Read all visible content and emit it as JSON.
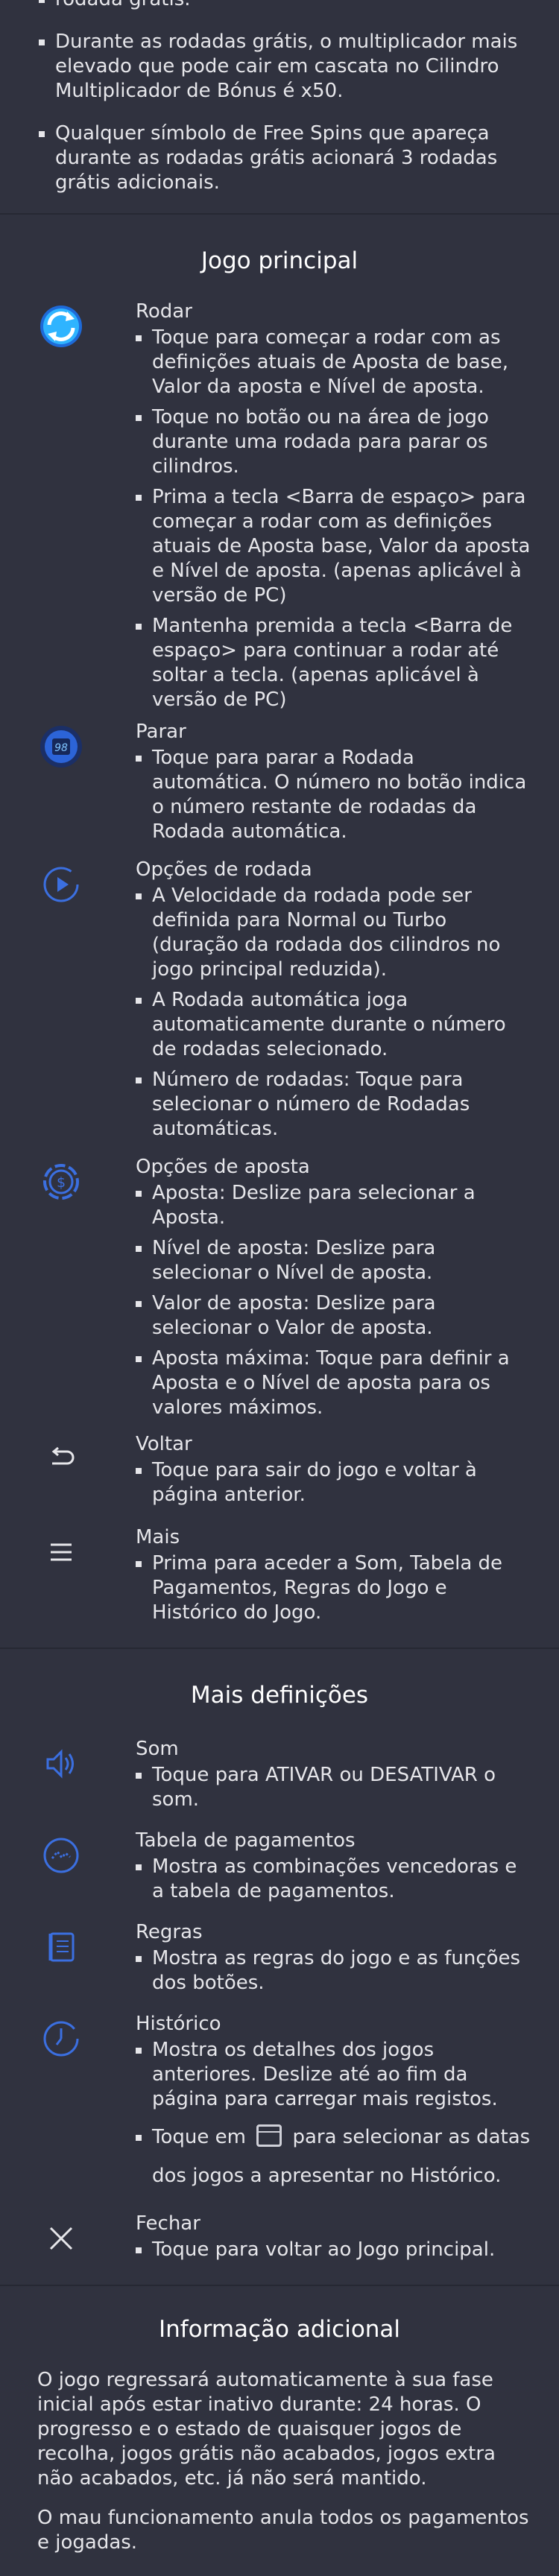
{
  "intro": {
    "bullets": [
      "rodada grátis.",
      "Durante as rodadas grátis, o multiplicador mais elevado que pode cair em cascata no Cilindro Multiplicador de Bónus é x50.",
      "Qualquer símbolo de Free Spins que apareça durante as rodadas grátis acionará 3 rodadas grátis adicionais."
    ]
  },
  "main_game": {
    "heading": "Jogo principal",
    "items": [
      {
        "icon": "spin-icon",
        "title": "Rodar",
        "bullets": [
          "Toque para começar a rodar com as definições atuais de Aposta de base, Valor da aposta e Nível de aposta.",
          "Toque no botão ou na área de jogo durante uma rodada para parar os cilindros.",
          "Prima a tecla <Barra de espaço> para começar a rodar com as definições atuais de Aposta base, Valor da aposta e Nível de aposta. (apenas aplicável à versão de PC)",
          "Mantenha premida a tecla <Barra de espaço> para continuar a rodar até soltar a tecla. (apenas aplicável à versão de PC)"
        ]
      },
      {
        "icon": "stop-icon",
        "icon_text": "98",
        "title": "Parar",
        "bullets": [
          "Toque para parar a Rodada automática. O número no botão indica o número restante de rodadas da Rodada automática."
        ]
      },
      {
        "icon": "spin-options-icon",
        "title": "Opções de rodada",
        "bullets": [
          "A Velocidade da rodada pode ser definida para Normal ou Turbo (duração da rodada dos cilindros no jogo principal reduzida).",
          "A Rodada automática joga automaticamente durante o número de rodadas selecionado.",
          "Número de rodadas: Toque para selecionar o número de Rodadas automáticas."
        ]
      },
      {
        "icon": "bet-options-icon",
        "title": "Opções de aposta",
        "bullets": [
          "Aposta: Deslize para selecionar a Aposta.",
          "Nível de aposta: Deslize para selecionar o Nível de aposta.",
          "Valor de aposta: Deslize para selecionar o Valor de aposta.",
          "Aposta máxima: Toque para definir a Aposta e o Nível de aposta para os valores máximos."
        ]
      },
      {
        "icon": "back-icon",
        "title": "Voltar",
        "bullets": [
          "Toque para sair do jogo e voltar à página anterior."
        ]
      },
      {
        "icon": "menu-icon",
        "title": "Mais",
        "bullets": [
          "Prima para aceder a Som, Tabela de Pagamentos, Regras do Jogo e Histórico do Jogo."
        ]
      }
    ]
  },
  "more_settings": {
    "heading": "Mais definições",
    "items": [
      {
        "icon": "sound-icon",
        "title": "Som",
        "bullets": [
          "Toque para ATIVAR ou DESATIVAR o som."
        ]
      },
      {
        "icon": "paytable-icon",
        "title": "Tabela de pagamentos",
        "bullets": [
          "Mostra as combinações vencedoras e a tabela de pagamentos."
        ]
      },
      {
        "icon": "rules-icon",
        "title": "Regras",
        "bullets": [
          "Mostra as regras do jogo e as funções dos botões."
        ]
      },
      {
        "icon": "history-icon",
        "title": "Histórico",
        "bullets": [
          "Mostra os detalhes dos jogos anteriores. Deslize até ao fim da página para carregar mais registos."
        ],
        "calendar_before": "Toque em",
        "calendar_after": "para selecionar as datas dos jogos a apresentar no Histórico."
      },
      {
        "icon": "close-icon",
        "title": "Fechar",
        "bullets": [
          "Toque para voltar ao Jogo principal."
        ]
      }
    ]
  },
  "additional_info": {
    "heading": "Informação adicional",
    "paragraphs": [
      "O jogo regressará automaticamente à sua fase inicial após estar inativo durante: 24 horas. O progresso e o estado de quaisquer jogos de recolha, jogos grátis não acabados, jogos extra não acabados, etc. já não será mantido.",
      "O mau funcionamento anula todos os pagamentos e jogadas."
    ]
  },
  "colors": {
    "background": "#30323f",
    "icon_blue": "#3b6fe0",
    "spin_cyan": "#2fb4ff",
    "divider": "#262833"
  }
}
